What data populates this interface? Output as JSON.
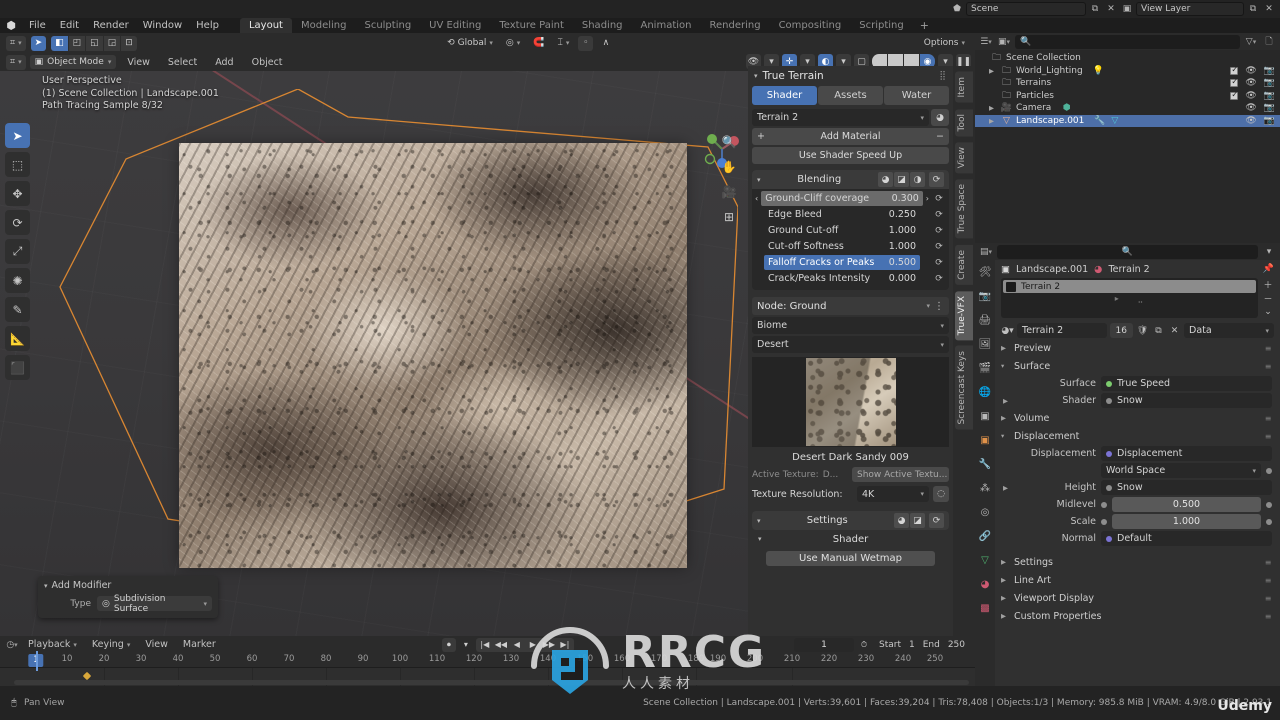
{
  "app": {
    "menus": [
      "File",
      "Edit",
      "Render",
      "Window",
      "Help"
    ],
    "workspaces": [
      "Layout",
      "Modeling",
      "Sculpting",
      "UV Editing",
      "Texture Paint",
      "Shading",
      "Animation",
      "Rendering",
      "Compositing",
      "Scripting"
    ],
    "workspace_active": "Layout",
    "add_tab": "+",
    "scene_name": "Scene",
    "view_layer_name": "View Layer"
  },
  "viewport_header": {
    "transform_orientation": "Global",
    "options_label": "Options",
    "mode": "Object Mode",
    "menus": [
      "View",
      "Select",
      "Add",
      "Object"
    ]
  },
  "viewport": {
    "overlay_lines": [
      "User Perspective",
      "(1) Scene Collection | Landscape.001",
      "Path Tracing Sample 8/32"
    ]
  },
  "add_modifier": {
    "title": "Add Modifier",
    "type_label": "Type",
    "type_value": "Subdivision Surface"
  },
  "npanel": {
    "title": "True Terrain",
    "tabs": [
      "Shader",
      "Assets",
      "Water"
    ],
    "tab_active": "Shader",
    "material_select": "Terrain 2",
    "add_material": "Add Material",
    "add_symbol": "+",
    "remove_symbol": "−",
    "speed_up": "Use Shader Speed Up",
    "blending": {
      "title": "Blending",
      "params": [
        {
          "name": "Ground-Cliff coverage",
          "value": "0.300",
          "state": "hover"
        },
        {
          "name": "Edge Bleed",
          "value": "0.250",
          "state": "normal"
        },
        {
          "name": "Ground Cut-off",
          "value": "1.000",
          "state": "normal"
        },
        {
          "name": "Cut-off Softness",
          "value": "1.000",
          "state": "normal"
        },
        {
          "name": "Falloff Cracks or Peaks",
          "value": "0.500",
          "state": "selected"
        },
        {
          "name": "Crack/Peaks Intensity",
          "value": "0.000",
          "state": "normal"
        }
      ]
    },
    "node": {
      "title": "Node: Ground",
      "biome_label": "Biome",
      "biome_value": "Desert",
      "texture_name": "Desert Dark Sandy 009",
      "active_texture_label": "Active Texture:",
      "active_texture_value": "D...",
      "show_active_texture": "Show Active Textu...",
      "resolution_label": "Texture Resolution:",
      "resolution_value": "4K"
    },
    "settings": {
      "title": "Settings",
      "shader_label": "Shader",
      "wetmap_button": "Use Manual Wetmap"
    },
    "vertical_tabs": [
      "Item",
      "Tool",
      "View",
      "True Space",
      "Create",
      "True-VFX",
      "Screencast Keys"
    ],
    "vertical_tab_active": "True-VFX"
  },
  "outliner": {
    "search_placeholder": "",
    "rows": [
      {
        "label": "Scene Collection",
        "indent": 0,
        "icon": "collection-icon",
        "expandable": false,
        "checkbox": false,
        "eye": false,
        "camera": false,
        "selected": false
      },
      {
        "label": "World_Lighting",
        "indent": 1,
        "icon": "collection-icon",
        "expandable": true,
        "checkbox": true,
        "eye": true,
        "camera": true,
        "selected": false,
        "extra": "light-icon"
      },
      {
        "label": "Terrains",
        "indent": 1,
        "icon": "collection-icon",
        "expandable": false,
        "checkbox": true,
        "eye": true,
        "camera": true,
        "selected": false
      },
      {
        "label": "Particles",
        "indent": 1,
        "icon": "collection-icon",
        "expandable": false,
        "checkbox": true,
        "eye": true,
        "camera": true,
        "selected": false
      },
      {
        "label": "Camera",
        "indent": 1,
        "icon": "camera-icon",
        "expandable": true,
        "checkbox": false,
        "eye": true,
        "camera": true,
        "selected": false,
        "extra": "mesh-data-icon"
      },
      {
        "label": "Landscape.001",
        "indent": 1,
        "icon": "mesh-icon",
        "expandable": true,
        "checkbox": false,
        "eye": true,
        "camera": true,
        "selected": true,
        "extra": "modifier-icon"
      }
    ]
  },
  "properties": {
    "breadcrumb_object": "Landscape.001",
    "breadcrumb_material": "Terrain 2",
    "material_slot": "Terrain 2",
    "material_name": "Terrain 2",
    "material_users": "16",
    "datablock_label": "Data",
    "sections": {
      "preview": "Preview",
      "surface": "Surface",
      "volume": "Volume",
      "displacement": "Displacement",
      "settings": "Settings",
      "line_art": "Line Art",
      "viewport_display": "Viewport Display",
      "custom_properties": "Custom Properties"
    },
    "surface_fields": [
      {
        "label": "Surface",
        "value": "True Speed",
        "socket": "green"
      },
      {
        "label": "Shader",
        "value": "Snow",
        "socket": "grey",
        "expandable": true
      }
    ],
    "displacement_fields": [
      {
        "label": "Displacement",
        "value": "Displacement",
        "socket": "purple"
      },
      {
        "label": "",
        "value": "World Space",
        "socket": "none",
        "dropdown": true
      },
      {
        "label": "Height",
        "value": "Snow",
        "socket": "grey",
        "expandable": true
      },
      {
        "label": "Midlevel",
        "value": "0.500",
        "socket": "grey",
        "slider": true
      },
      {
        "label": "Scale",
        "value": "1.000",
        "socket": "grey",
        "slider": true
      },
      {
        "label": "Normal",
        "value": "Default",
        "socket": "purple"
      }
    ]
  },
  "timeline": {
    "menus": [
      "Playback",
      "Keying",
      "View",
      "Marker"
    ],
    "current_frame": "1",
    "start_label": "Start",
    "start_value": "1",
    "end_label": "End",
    "end_value": "250",
    "ticks": [
      "10",
      "20",
      "30",
      "40",
      "50",
      "60",
      "70",
      "80",
      "90",
      "100",
      "110",
      "120",
      "130",
      "140",
      "150",
      "160",
      "170",
      "180",
      "190",
      "200",
      "210",
      "220",
      "230",
      "240",
      "250"
    ],
    "playhead_label": "1"
  },
  "statusbar": {
    "left_items": [
      "Pan View"
    ],
    "stats": "Scene Collection | Landscape.001 | Verts:39,601 | Faces:39,204 | Tris:78,408 | Objects:1/3 | Memory: 985.8 MiB | VRAM: 4.9/8.0 GiB | 2.93.1"
  },
  "watermarks": {
    "rrcg": "RRCG",
    "rrcg_sub": "人人素材",
    "udemy": "Udemy"
  },
  "colors": {
    "accent_blue": "#4772b3",
    "panel_bg": "#303030",
    "editor_bg": "#282828",
    "header_bg": "#2b2b2b"
  }
}
